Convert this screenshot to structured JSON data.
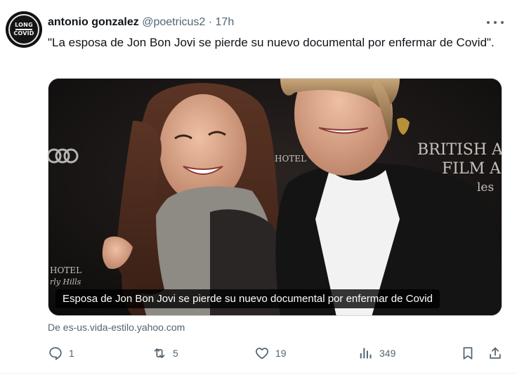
{
  "author": {
    "name": "antonio gonzalez",
    "handle": "@poetricus2",
    "separator": "·",
    "time": "17h",
    "avatar_lines": [
      "LONG",
      "COVID"
    ]
  },
  "tweet": {
    "text": "\"La esposa de Jon Bon Jovi se pierde su nuevo documental por enfermar de Covid\"."
  },
  "card": {
    "caption": "Esposa de Jon Bon Jovi se pierde su nuevo documental por enfermar de Covid",
    "backdrop_text": [
      "BRITISH AC",
      "FILM A",
      "les",
      "HOTEL",
      "rly Hills",
      "HOTEL"
    ],
    "source": "De es-us.vida-estilo.yahoo.com"
  },
  "actions": {
    "reply": {
      "icon": "reply-icon",
      "count": "1"
    },
    "retweet": {
      "icon": "retweet-icon",
      "count": "5"
    },
    "like": {
      "icon": "heart-icon",
      "count": "19"
    },
    "views": {
      "icon": "views-icon",
      "count": "349"
    },
    "bookmark": {
      "icon": "bookmark-icon"
    },
    "share": {
      "icon": "share-icon"
    }
  },
  "colors": {
    "text": "#0f1419",
    "secondary": "#536471",
    "border": "#cfd9de"
  }
}
